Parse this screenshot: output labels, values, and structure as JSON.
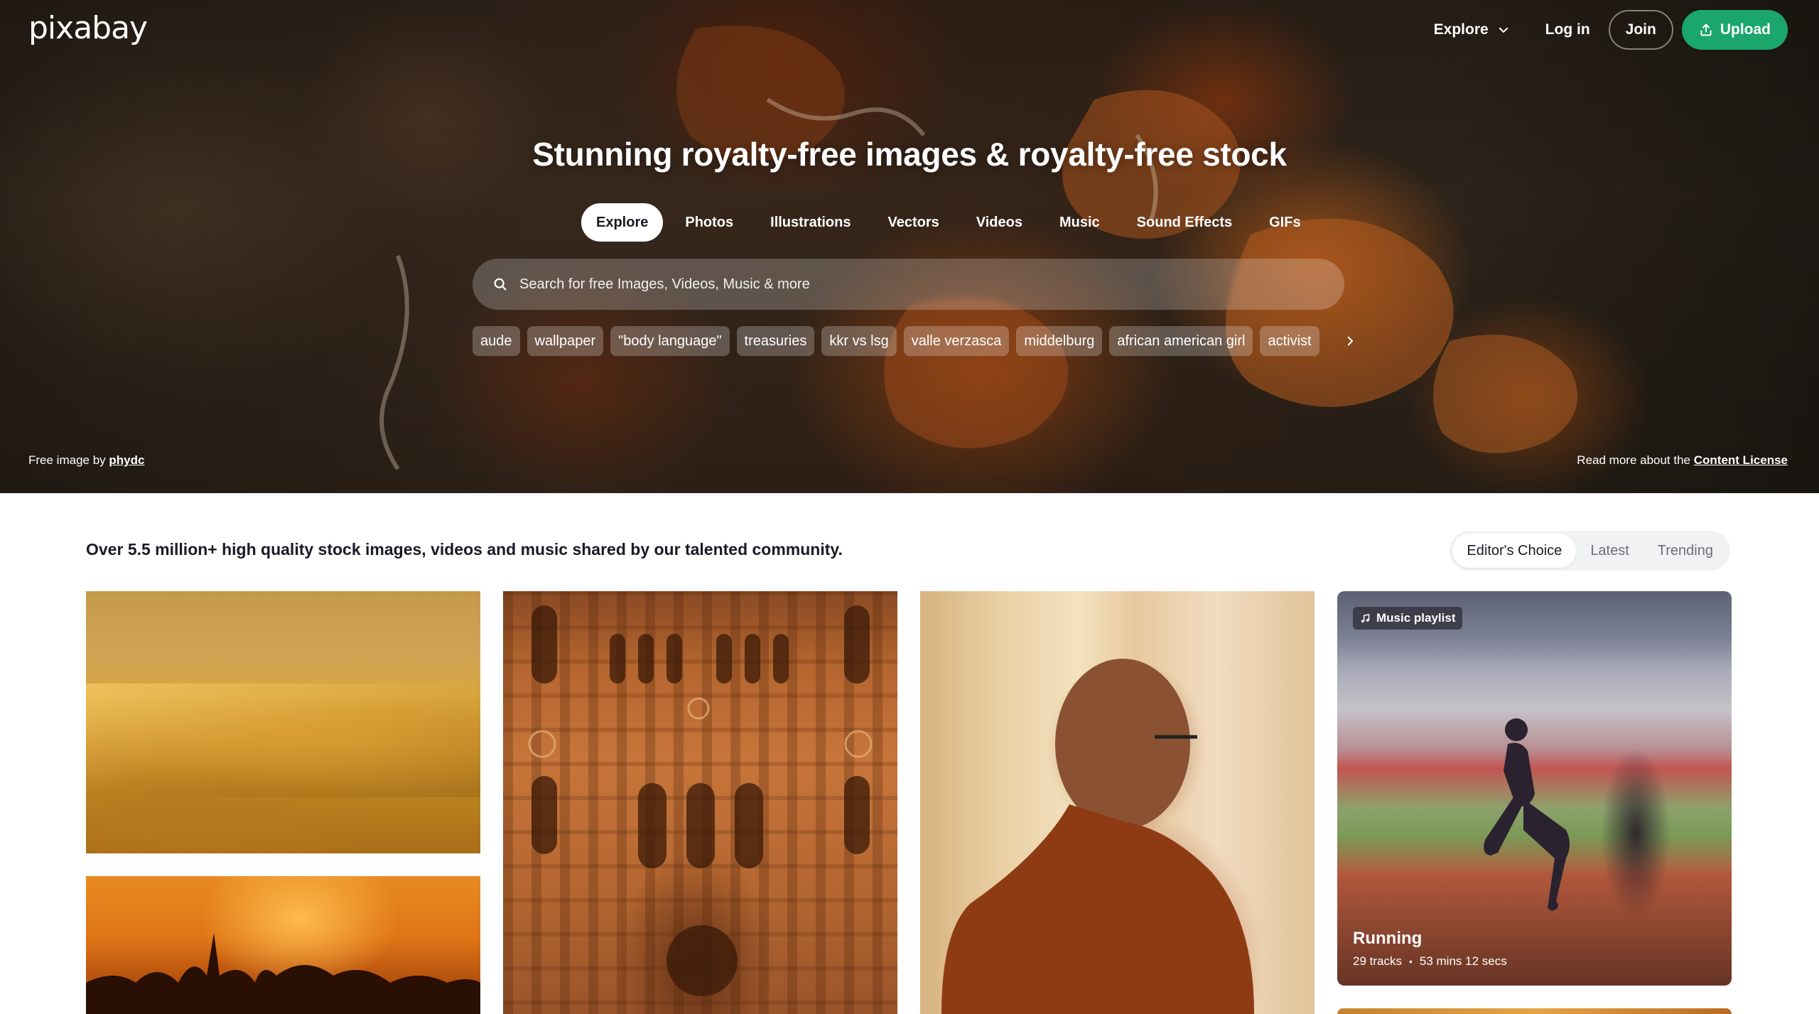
{
  "brand": {
    "logo_text": "pixabay",
    "accent": "#1ba66b"
  },
  "topnav": {
    "explore_label": "Explore",
    "login_label": "Log in",
    "join_label": "Join",
    "upload_label": "Upload"
  },
  "hero": {
    "title": "Stunning royalty-free images & royalty-free stock",
    "tabs": [
      {
        "label": "Explore",
        "active": true
      },
      {
        "label": "Photos"
      },
      {
        "label": "Illustrations"
      },
      {
        "label": "Vectors"
      },
      {
        "label": "Videos"
      },
      {
        "label": "Music"
      },
      {
        "label": "Sound Effects"
      },
      {
        "label": "GIFs"
      }
    ],
    "search": {
      "placeholder": "Search for free Images, Videos, Music & more",
      "value": ""
    },
    "chips": [
      "aude",
      "wallpaper",
      "\"body language\"",
      "treasuries",
      "kkr vs lsg",
      "valle verzasca",
      "middelburg",
      "african american girl",
      "activist"
    ],
    "credit_prefix": "Free image by",
    "credit_author": "phydc",
    "license_prefix": "Read more about the",
    "license_link": "Content License"
  },
  "main": {
    "intro": "Over 5.5 million+ high quality stock images, videos and music shared by our talented community.",
    "sort_tabs": [
      {
        "label": "Editor's Choice",
        "active": true
      },
      {
        "label": "Latest"
      },
      {
        "label": "Trending"
      }
    ],
    "playlist": {
      "badge": "Music playlist",
      "title": "Running",
      "tracks": "29 tracks",
      "duration": "53 mins 12 secs"
    }
  }
}
